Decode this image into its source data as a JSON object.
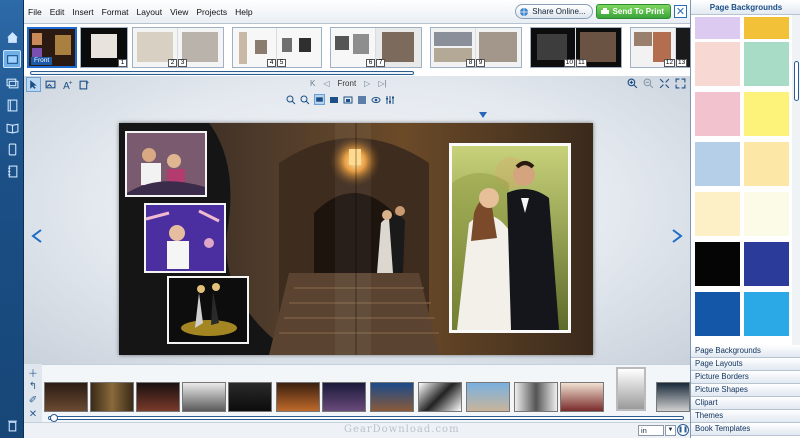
{
  "menu": [
    "File",
    "Edit",
    "Insert",
    "Format",
    "Layout",
    "View",
    "Projects",
    "Help"
  ],
  "share_label": "Share Online...",
  "send_label": "Send To Print",
  "close_symbol": "✕",
  "page_strip": {
    "front_badge": "Front",
    "page_numbers": [
      "1",
      "2",
      "3",
      "4",
      "5",
      "6",
      "7",
      "8",
      "9",
      "10",
      "11",
      "12",
      "13"
    ]
  },
  "pager": {
    "first": "K",
    "prev": "◁",
    "current": "Front",
    "next": "▷",
    "last": "▷|"
  },
  "units": {
    "value": "in",
    "dropdown": "▼"
  },
  "watermark": "GearDownload.com",
  "right_panel": {
    "title": "Page Backgrounds",
    "swatch_colors": [
      "#dccaf0",
      "#f2c137",
      "#f8d8d2",
      "#a9dcc7",
      "#f2c3cf",
      "#fdf27a",
      "#b5cfe8",
      "#fde7a6",
      "#fdf0c7",
      "#fcfbe8",
      "#050505",
      "#2b3b9a",
      "#1456a8",
      "#2aa9e6"
    ],
    "sections": [
      "Page Backgrounds",
      "Page Layouts",
      "Picture Borders",
      "Picture Shapes",
      "Clipart",
      "Themes",
      "Book Templates"
    ]
  },
  "colors": {
    "accent": "#1b4f86",
    "send_green": "#3aa33a",
    "selection": "#1d6ad1"
  },
  "icons": {
    "rail": [
      "home-icon",
      "pages-icon",
      "layers-icon",
      "book-icon",
      "phone-icon",
      "spiral-book-icon"
    ],
    "toolbar": [
      "select-icon",
      "image-icon",
      "add-text-icon",
      "add-page-icon"
    ],
    "bottom": [
      "add-icon",
      "share-icon",
      "brush-icon",
      "remove-icon"
    ]
  }
}
